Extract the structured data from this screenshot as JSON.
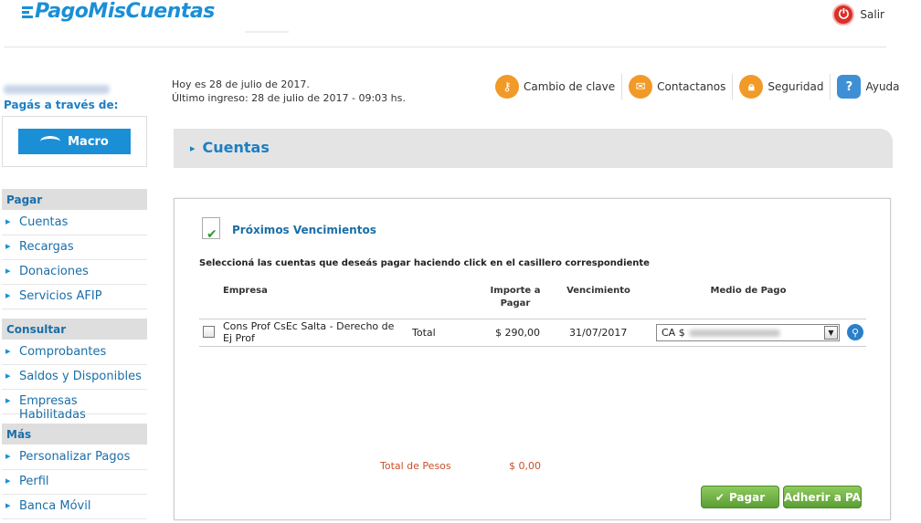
{
  "header": {
    "logo_text": "PagoMisCuentas",
    "exit_label": "Salir"
  },
  "sidebar": {
    "pay_through": "Pagás a través de:",
    "bank_name": "Macro",
    "sections": [
      {
        "title": "Pagar",
        "items": [
          "Cuentas",
          "Recargas",
          "Donaciones",
          "Servicios AFIP"
        ]
      },
      {
        "title": "Consultar",
        "items": [
          "Comprobantes",
          "Saldos y Disponibles",
          "Empresas Habilitadas"
        ]
      },
      {
        "title": "Más",
        "items": [
          "Personalizar Pagos",
          "Perfil",
          "Banca Móvil"
        ]
      }
    ]
  },
  "info": {
    "today": "Hoy es 28 de julio de 2017.",
    "last_login": "Último ingreso: 28 de julio de 2017 - 09:03 hs."
  },
  "toplinks": {
    "change_key": "Cambio de clave",
    "contact": "Contactanos",
    "security": "Seguridad",
    "help": "Ayuda"
  },
  "page": {
    "title": "Cuentas"
  },
  "panel": {
    "title": "Próximos Vencimientos",
    "instruction": "Seleccioná las cuentas que deseás pagar haciendo click en el casillero correspondiente",
    "columns": {
      "empresa": "Empresa",
      "importe": "Importe a Pagar",
      "vencimiento": "Vencimiento",
      "medio": "Medio de Pago"
    },
    "rows": [
      {
        "empresa": "Cons Prof CsEc Salta - Derecho de Ej Prof",
        "tipo": "Total",
        "importe": "$ 290,00",
        "vencimiento": "31/07/2017",
        "medio": "CA $"
      }
    ],
    "total_label": "Total de Pesos",
    "total_value": "$ 0,00",
    "pay_button": "Pagar",
    "adhere_button": "Adherir a PA"
  }
}
